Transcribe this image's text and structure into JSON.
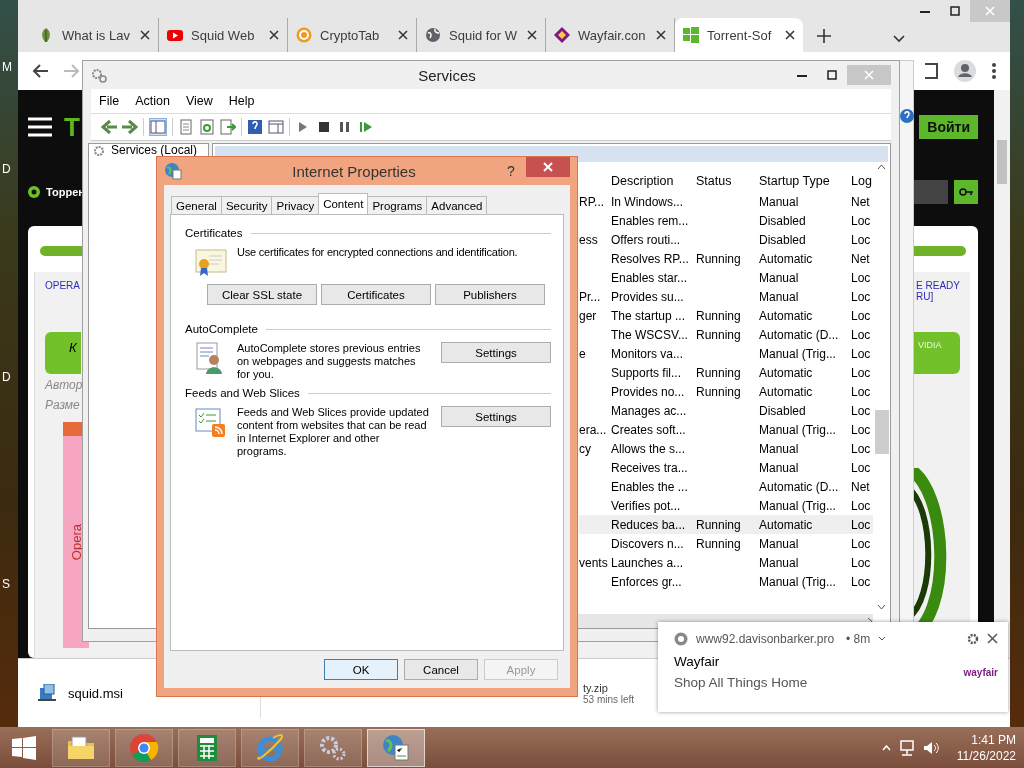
{
  "desktop": {
    "edge_labels": [
      "M",
      "D",
      "D",
      "S"
    ]
  },
  "browser": {
    "tabs": [
      {
        "kind": "leaf",
        "title": "What is Lav",
        "selected": false
      },
      {
        "kind": "video",
        "title": "Squid Web",
        "selected": false
      },
      {
        "kind": "coin",
        "title": "CryptoTab",
        "selected": false
      },
      {
        "kind": "globe",
        "title": "Squid for W",
        "selected": false
      },
      {
        "kind": "diamond",
        "title": "Wayfair.con",
        "selected": false
      },
      {
        "kind": "windows",
        "title": "Torrent-Sof",
        "selected": true
      }
    ],
    "page": {
      "logo_fragment": "T",
      "login_button": "Войти",
      "site_label": "Торрен",
      "link_left": "OPERA",
      "link_right": [
        "E READY",
        "RU]"
      ],
      "green_left": "К",
      "green_right": "VIDIA",
      "meta": [
        "Автор",
        "Разме"
      ],
      "cover_text": "Opera"
    },
    "downloads": [
      {
        "name": "squid.msi"
      },
      {
        "name": "ty.zip",
        "status": "53 mins left"
      }
    ]
  },
  "services": {
    "title": "Services",
    "menu": [
      "File",
      "Action",
      "View",
      "Help"
    ],
    "tree": [
      "Services (Local)"
    ],
    "columns": [
      "Description",
      "Status",
      "Startup Type",
      "Log"
    ],
    "rows": [
      {
        "name": "RP...",
        "description": "In Windows...",
        "status": "",
        "startup": "Manual",
        "log": "Net",
        "selected": false
      },
      {
        "name": "",
        "description": "Enables rem...",
        "status": "",
        "startup": "Disabled",
        "log": "Loc",
        "selected": false
      },
      {
        "name": "ess",
        "description": "Offers routi...",
        "status": "",
        "startup": "Disabled",
        "log": "Loc",
        "selected": false
      },
      {
        "name": "",
        "description": "Resolves RP...",
        "status": "Running",
        "startup": "Automatic",
        "log": "Net",
        "selected": false
      },
      {
        "name": "",
        "description": "Enables star...",
        "status": "",
        "startup": "Manual",
        "log": "Loc",
        "selected": false
      },
      {
        "name": "Pr...",
        "description": "Provides su...",
        "status": "",
        "startup": "Manual",
        "log": "Loc",
        "selected": false
      },
      {
        "name": "ger",
        "description": "The startup ...",
        "status": "Running",
        "startup": "Automatic",
        "log": "Loc",
        "selected": false
      },
      {
        "name": "",
        "description": "The WSCSV...",
        "status": "Running",
        "startup": "Automatic (D...",
        "log": "Loc",
        "selected": false
      },
      {
        "name": "e",
        "description": "Monitors va...",
        "status": "",
        "startup": "Manual (Trig...",
        "log": "Loc",
        "selected": false
      },
      {
        "name": "",
        "description": "Supports fil...",
        "status": "Running",
        "startup": "Automatic",
        "log": "Loc",
        "selected": false
      },
      {
        "name": "",
        "description": "Provides no...",
        "status": "Running",
        "startup": "Automatic",
        "log": "Loc",
        "selected": false
      },
      {
        "name": "",
        "description": "Manages ac...",
        "status": "",
        "startup": "Disabled",
        "log": "Loc",
        "selected": false
      },
      {
        "name": "era...",
        "description": "Creates soft...",
        "status": "",
        "startup": "Manual (Trig...",
        "log": "Loc",
        "selected": false
      },
      {
        "name": "cy",
        "description": "Allows the s...",
        "status": "",
        "startup": "Manual",
        "log": "Loc",
        "selected": false
      },
      {
        "name": "",
        "description": "Receives tra...",
        "status": "",
        "startup": "Manual",
        "log": "Loc",
        "selected": false
      },
      {
        "name": "",
        "description": "Enables the ...",
        "status": "",
        "startup": "Automatic (D...",
        "log": "Net",
        "selected": false
      },
      {
        "name": "",
        "description": "Verifies pot...",
        "status": "",
        "startup": "Manual (Trig...",
        "log": "Loc",
        "selected": false
      },
      {
        "name": "",
        "description": "Reduces ba...",
        "status": "Running",
        "startup": "Automatic",
        "log": "Loc",
        "selected": true
      },
      {
        "name": "",
        "description": "Discovers n...",
        "status": "Running",
        "startup": "Manual",
        "log": "Loc",
        "selected": false
      },
      {
        "name": "vents",
        "description": "Launches a...",
        "status": "",
        "startup": "Manual",
        "log": "Loc",
        "selected": false
      },
      {
        "name": "",
        "description": "Enforces gr...",
        "status": "",
        "startup": "Manual (Trig...",
        "log": "Loc",
        "selected": false
      }
    ]
  },
  "dialog": {
    "title": "Internet Properties",
    "help": "?",
    "tabs": [
      {
        "label": "General",
        "selected": false
      },
      {
        "label": "Security",
        "selected": false
      },
      {
        "label": "Privacy",
        "selected": false
      },
      {
        "label": "Content",
        "selected": true
      },
      {
        "label": "Programs",
        "selected": false
      },
      {
        "label": "Advanced",
        "selected": false
      }
    ],
    "sections": [
      {
        "kind": "certificates",
        "heading": "Certificates",
        "text": "Use certificates for encrypted connections and identification.",
        "buttons": [
          "Clear SSL state",
          "Certificates",
          "Publishers"
        ]
      },
      {
        "kind": "autocomplete",
        "heading": "AutoComplete",
        "text": "AutoComplete stores previous entries on webpages and suggests matches for you.",
        "buttons": [
          "Settings"
        ]
      },
      {
        "kind": "feeds",
        "heading": "Feeds and Web Slices",
        "text": "Feeds and Web Slices provide updated content from websites that can be read in Internet Explorer and other programs.",
        "buttons": [
          "Settings"
        ]
      }
    ],
    "footer": [
      {
        "label": "OK",
        "default": true,
        "disabled": false
      },
      {
        "label": "Cancel",
        "default": false,
        "disabled": false
      },
      {
        "label": "Apply",
        "default": false,
        "disabled": true
      }
    ]
  },
  "notification": {
    "source": "www92.davisonbarker.pro",
    "age": "• 8m",
    "title": "Wayfair",
    "body": "Shop All Things Home",
    "logo": "wayfair"
  },
  "taskbar": {
    "items": [
      {
        "kind": "folder",
        "selected": false
      },
      {
        "kind": "chrome",
        "selected": false
      },
      {
        "kind": "calculator",
        "selected": false
      },
      {
        "kind": "ie",
        "selected": false
      },
      {
        "kind": "gears",
        "selected": false
      },
      {
        "kind": "internet-properties",
        "selected": true
      }
    ],
    "time": "1:41 PM",
    "date": "11/26/2022"
  }
}
